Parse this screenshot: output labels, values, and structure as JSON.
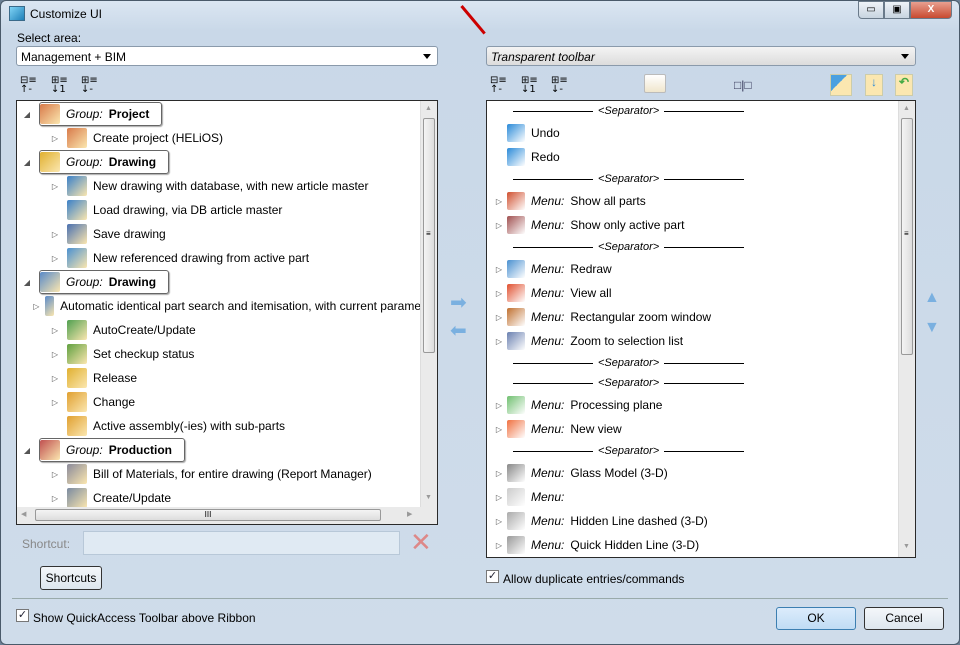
{
  "window": {
    "title": "Customize UI",
    "min": "▭",
    "max": "▣",
    "close": "X"
  },
  "left": {
    "area_label": "Select area:",
    "area_value": "Management + BIM",
    "items": [
      {
        "type": "group",
        "level": 0,
        "prefix": "Group:",
        "label": "Project",
        "color": "#d87a4a"
      },
      {
        "type": "item",
        "level": 1,
        "expander": true,
        "label": "Create project (HELiOS)",
        "color": "#d87a4a"
      },
      {
        "type": "group",
        "level": 0,
        "prefix": "Group:",
        "label": "Drawing",
        "color": "#e0b030"
      },
      {
        "type": "item",
        "level": 1,
        "expander": true,
        "label": "New drawing with database, with new article master",
        "color": "#3a80c8"
      },
      {
        "type": "item",
        "level": 1,
        "expander": false,
        "label": "Load drawing, via DB article master",
        "color": "#3a80c8"
      },
      {
        "type": "item",
        "level": 1,
        "expander": true,
        "label": "Save drawing",
        "color": "#4a70b0"
      },
      {
        "type": "item",
        "level": 1,
        "expander": true,
        "label": "New referenced drawing from active part",
        "color": "#4a90d0"
      },
      {
        "type": "group",
        "level": 0,
        "prefix": "Group:",
        "label": "Drawing",
        "color": "#5a8ac8"
      },
      {
        "type": "item",
        "level": 1,
        "expander": true,
        "label": "Automatic identical part search and itemisation, with current parame",
        "color": "#5a8ac8"
      },
      {
        "type": "item",
        "level": 1,
        "expander": true,
        "label": "AutoCreate/Update",
        "color": "#50a050"
      },
      {
        "type": "item",
        "level": 1,
        "expander": true,
        "label": "Set checkup status",
        "color": "#60a040"
      },
      {
        "type": "item",
        "level": 1,
        "expander": true,
        "label": "Release",
        "color": "#e0b030"
      },
      {
        "type": "item",
        "level": 1,
        "expander": true,
        "label": "Change",
        "color": "#e0a030"
      },
      {
        "type": "item",
        "level": 1,
        "expander": false,
        "label": "Active assembly(-ies) with sub-parts",
        "color": "#e0a030"
      },
      {
        "type": "group",
        "level": 0,
        "prefix": "Group:",
        "label": "Production",
        "color": "#c05050"
      },
      {
        "type": "item",
        "level": 1,
        "expander": true,
        "label": "Bill of Materials, for entire drawing (Report Manager)",
        "color": "#8a8a9a"
      },
      {
        "type": "item",
        "level": 1,
        "expander": true,
        "label": "Create/Update",
        "color": "#7a8aa0"
      }
    ],
    "shortcut_label": "Shortcut:",
    "shortcut_value": "",
    "shortcuts_button": "Shortcuts"
  },
  "right": {
    "toolbar_value": "Transparent toolbar",
    "items": [
      {
        "type": "sep",
        "label": "<Separator>"
      },
      {
        "type": "cmd",
        "label": "Undo",
        "color": "#2a8ad8"
      },
      {
        "type": "cmd",
        "label": "Redo",
        "color": "#2a8ad8"
      },
      {
        "type": "sep",
        "label": "<Separator>"
      },
      {
        "type": "menu",
        "prefix": "Menu:",
        "label": "Show all parts",
        "color": "#d05030"
      },
      {
        "type": "menu",
        "prefix": "Menu:",
        "label": "Show only active part",
        "color": "#a05050"
      },
      {
        "type": "sep",
        "label": "<Separator>"
      },
      {
        "type": "menu",
        "prefix": "Menu:",
        "label": "Redraw",
        "color": "#4a90d0"
      },
      {
        "type": "menu",
        "prefix": "Menu:",
        "label": "View all",
        "color": "#e05030"
      },
      {
        "type": "menu",
        "prefix": "Menu:",
        "label": "Rectangular zoom window",
        "color": "#c07030"
      },
      {
        "type": "menu",
        "prefix": "Menu:",
        "label": "Zoom to selection list",
        "color": "#6a80b0"
      },
      {
        "type": "sep",
        "label": "<Separator>"
      },
      {
        "type": "sep",
        "label": "<Separator>"
      },
      {
        "type": "menu",
        "prefix": "Menu:",
        "label": "Processing plane",
        "color": "#70c070"
      },
      {
        "type": "menu",
        "prefix": "Menu:",
        "label": "New view",
        "color": "#f07040"
      },
      {
        "type": "sep",
        "label": "<Separator>"
      },
      {
        "type": "menu",
        "prefix": "Menu:",
        "label": "Glass Model (3-D)",
        "color": "#888"
      },
      {
        "type": "menu",
        "prefix": "Menu:",
        "label": "",
        "color": "#ccc"
      },
      {
        "type": "menu",
        "prefix": "Menu:",
        "label": "Hidden Line dashed (3-D)",
        "color": "#aaa"
      },
      {
        "type": "menu",
        "prefix": "Menu:",
        "label": "Quick Hidden Line (3-D)",
        "color": "#999"
      }
    ],
    "allow_duplicates_label": "Allow duplicate entries/commands",
    "allow_duplicates": true
  },
  "footer": {
    "show_qat_label": "Show QuickAccess Toolbar above Ribbon",
    "show_qat": true,
    "ok": "OK",
    "cancel": "Cancel"
  },
  "glyphs": {
    "check": "✓",
    "delete": "✕",
    "hscroll_grip": "III",
    "grip": "≡",
    "up": "▲",
    "down": "▼",
    "left": "◀",
    "right": "▶"
  }
}
